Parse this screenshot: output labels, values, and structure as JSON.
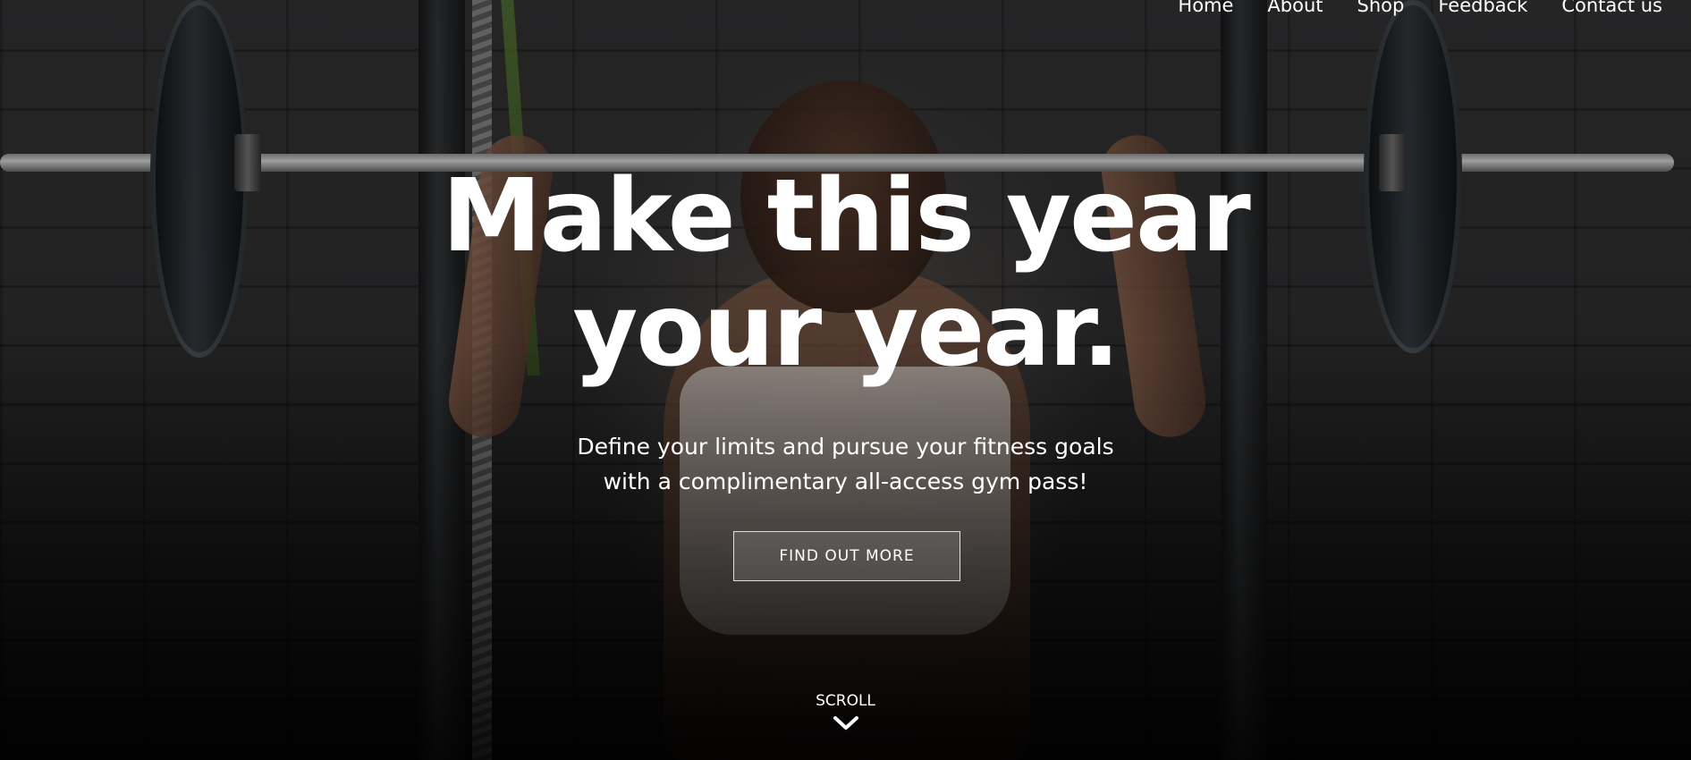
{
  "nav": {
    "items": [
      {
        "label": "Home"
      },
      {
        "label": "About"
      },
      {
        "label": "Shop"
      },
      {
        "label": "Feedback"
      },
      {
        "label": "Contact us"
      }
    ]
  },
  "hero": {
    "headline_line1": "Make this year",
    "headline_line2": "your year.",
    "subtitle_line1": "Define your limits and pursue your fitness goals",
    "subtitle_line2": "with a complimentary all-access gym pass!",
    "cta_label": "FIND OUT MORE",
    "scroll_label": "SCROLL",
    "scroll_icon": "chevron-down-icon"
  },
  "colors": {
    "text": "#ffffff",
    "button_border": "#e0e0e0",
    "background": "#1e1e1f"
  }
}
